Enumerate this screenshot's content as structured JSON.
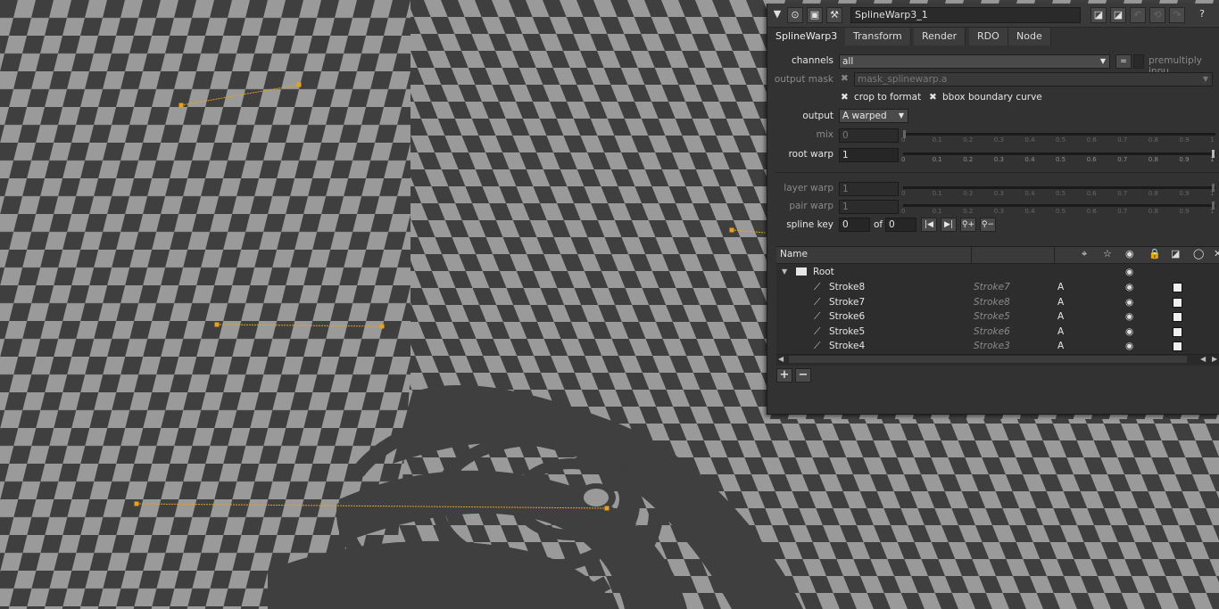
{
  "viewer": {
    "colors": {
      "dark": "#3f3f3f",
      "light": "#9a9a9a",
      "spline": "#e8a21a"
    }
  },
  "panel": {
    "collapse_icon": "triangle-down-icon",
    "toolbar_icons": [
      "disable-icon",
      "node-icon",
      "wrench-icon"
    ],
    "node_name": "SplineWarp3_1",
    "right_icons": [
      "color-swatch-icon",
      "color-swatch-icon",
      "undo-icon",
      "revert-icon",
      "redo-icon",
      "help-icon"
    ],
    "help_label": "?",
    "tabs": [
      {
        "label": "SplineWarp3",
        "active": true
      },
      {
        "label": "Transform"
      },
      {
        "label": "Render"
      },
      {
        "label": "RDO"
      },
      {
        "label": "Node"
      }
    ],
    "channels": {
      "label": "channels",
      "value": "all",
      "equal_label": "=",
      "premultiply_label": "premultiply inpu"
    },
    "output_mask": {
      "label": "output mask",
      "value": "mask_splinewarp.a"
    },
    "crop_to_format": {
      "label": "crop to format",
      "checked": true
    },
    "bbox_boundary_curve": {
      "label": "bbox boundary curve",
      "checked": true
    },
    "output": {
      "label": "output",
      "value": "A warped"
    },
    "mix": {
      "label": "mix",
      "value": "0",
      "slider": 0
    },
    "root_warp": {
      "label": "root warp",
      "value": "1",
      "slider": 1
    },
    "layer_warp": {
      "label": "layer warp",
      "value": "1",
      "slider": 1
    },
    "pair_warp": {
      "label": "pair warp",
      "value": "1",
      "slider": 1
    },
    "slider_ticks": [
      "0",
      "0.1",
      "0.2",
      "0.3",
      "0.4",
      "0.5",
      "0.6",
      "0.7",
      "0.8",
      "0.9",
      "1"
    ],
    "spline_key": {
      "label": "spline key",
      "value": "0",
      "of_label": "of",
      "total": "0",
      "buttons": [
        "prev-key-icon",
        "next-key-icon",
        "add-key-icon",
        "remove-key-icon"
      ]
    },
    "tree": {
      "header_name": "Name",
      "header_icons": [
        "pivot-icon",
        "star-icon",
        "eye-icon",
        "lock-icon",
        "color-swatch-icon",
        "ellipse-icon",
        "close-icon"
      ],
      "root_label": "Root",
      "rows": [
        {
          "name": "Stroke8",
          "pair": "Stroke7",
          "src": "A"
        },
        {
          "name": "Stroke7",
          "pair": "Stroke8",
          "src": "A"
        },
        {
          "name": "Stroke6",
          "pair": "Stroke5",
          "src": "A"
        },
        {
          "name": "Stroke5",
          "pair": "Stroke6",
          "src": "A"
        },
        {
          "name": "Stroke4",
          "pair": "Stroke3",
          "src": "A"
        }
      ]
    },
    "add_label": "+",
    "remove_label": "−"
  }
}
